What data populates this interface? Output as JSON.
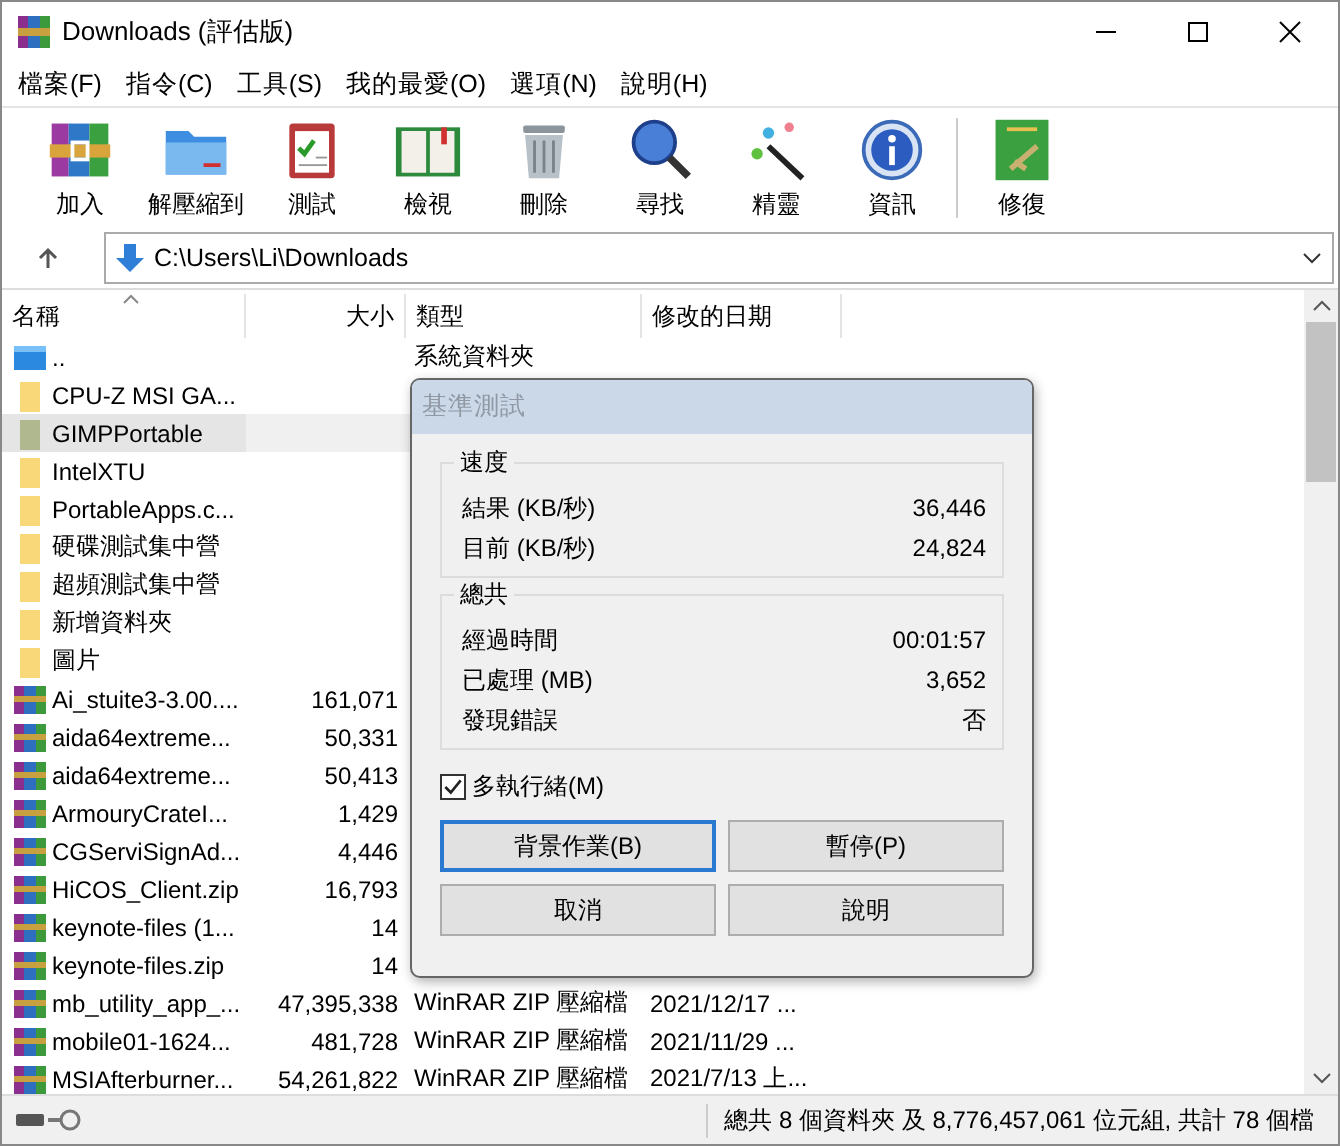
{
  "window": {
    "title": "Downloads (評估版)"
  },
  "menu": [
    "檔案(F)",
    "指令(C)",
    "工具(S)",
    "我的最愛(O)",
    "選項(N)",
    "說明(H)"
  ],
  "toolbar": [
    {
      "kind": "add",
      "label": "加入"
    },
    {
      "kind": "extract",
      "label": "解壓縮到"
    },
    {
      "kind": "test",
      "label": "測試"
    },
    {
      "kind": "view",
      "label": "檢視"
    },
    {
      "kind": "delete",
      "label": "刪除"
    },
    {
      "kind": "find",
      "label": "尋找"
    },
    {
      "kind": "wizard",
      "label": "精靈"
    },
    {
      "kind": "info",
      "label": "資訊"
    },
    {
      "kind": "repair",
      "label": "修復"
    }
  ],
  "address": {
    "value": "C:\\Users\\Li\\Downloads"
  },
  "table": {
    "columns": [
      "名稱",
      "大小",
      "類型",
      "修改的日期"
    ],
    "rows": [
      {
        "kind": "up",
        "name": "..",
        "size": "",
        "type": "系統資料夾",
        "date": "",
        "selected": false
      },
      {
        "kind": "folder",
        "name": "CPU-Z MSI GA...",
        "size": "",
        "type": "",
        "date": "",
        "selected": false
      },
      {
        "kind": "folder",
        "name": "GIMPPortable",
        "size": "",
        "type": "",
        "date": "",
        "selected": true
      },
      {
        "kind": "folder",
        "name": "IntelXTU",
        "size": "",
        "type": "",
        "date": "",
        "selected": false
      },
      {
        "kind": "folder",
        "name": "PortableApps.c...",
        "size": "",
        "type": "",
        "date": "",
        "selected": false
      },
      {
        "kind": "folder",
        "name": "硬碟測試集中營",
        "size": "",
        "type": "",
        "date": "",
        "selected": false
      },
      {
        "kind": "folder",
        "name": "超頻測試集中營",
        "size": "",
        "type": "",
        "date": "",
        "selected": false
      },
      {
        "kind": "folder",
        "name": "新增資料夾",
        "size": "",
        "type": "",
        "date": "",
        "selected": false
      },
      {
        "kind": "folder",
        "name": "圖片",
        "size": "",
        "type": "",
        "date": "",
        "selected": false
      },
      {
        "kind": "archive",
        "name": "Ai_stuite3-3.00....",
        "size": "161,071",
        "type": "",
        "date": "",
        "selected": false
      },
      {
        "kind": "archive",
        "name": "aida64extreme...",
        "size": "50,331",
        "type": "",
        "date": "",
        "selected": false
      },
      {
        "kind": "archive",
        "name": "aida64extreme...",
        "size": "50,413",
        "type": "",
        "date": "",
        "selected": false
      },
      {
        "kind": "archive",
        "name": "ArmouryCrateI...",
        "size": "1,429",
        "type": "",
        "date": "",
        "selected": false
      },
      {
        "kind": "archive",
        "name": "CGServiSignAd...",
        "size": "4,446",
        "type": "",
        "date": "",
        "selected": false
      },
      {
        "kind": "archive",
        "name": "HiCOS_Client.zip",
        "size": "16,793",
        "type": "",
        "date": "",
        "selected": false
      },
      {
        "kind": "archive",
        "name": "keynote-files (1...",
        "size": "14",
        "type": "",
        "date": "",
        "selected": false
      },
      {
        "kind": "archive",
        "name": "keynote-files.zip",
        "size": "14",
        "type": "",
        "date": "",
        "selected": false
      },
      {
        "kind": "archive",
        "name": "mb_utility_app_...",
        "size": "47,395,338",
        "type": "WinRAR ZIP 壓縮檔",
        "date": "2021/12/17 ...",
        "selected": false
      },
      {
        "kind": "archive",
        "name": "mobile01-1624...",
        "size": "481,728",
        "type": "WinRAR ZIP 壓縮檔",
        "date": "2021/11/29 ...",
        "selected": false
      },
      {
        "kind": "archive",
        "name": "MSIAfterburner...",
        "size": "54,261,822",
        "type": "WinRAR ZIP 壓縮檔",
        "date": "2021/7/13 上...",
        "selected": false
      }
    ]
  },
  "dialog": {
    "title": "基準測試",
    "groups": [
      {
        "title": "速度",
        "rows": [
          {
            "label": "結果 (KB/秒)",
            "value": "36,446"
          },
          {
            "label": "目前 (KB/秒)",
            "value": "24,824"
          }
        ]
      },
      {
        "title": "總共",
        "rows": [
          {
            "label": "經過時間",
            "value": "00:01:57"
          },
          {
            "label": "已處理 (MB)",
            "value": "3,652"
          },
          {
            "label": "發現錯誤",
            "value": "否"
          }
        ]
      }
    ],
    "multithread": {
      "label": "多執行緒(M)",
      "checked": true
    },
    "buttons": [
      {
        "label": "背景作業(B)",
        "default": true
      },
      {
        "label": "暫停(P)",
        "default": false
      },
      {
        "label": "取消",
        "default": false
      },
      {
        "label": "說明",
        "default": false
      }
    ]
  },
  "status_bar": {
    "text": "總共 8 個資料夾 及 8,776,457,061 位元組, 共計 78 個檔"
  }
}
